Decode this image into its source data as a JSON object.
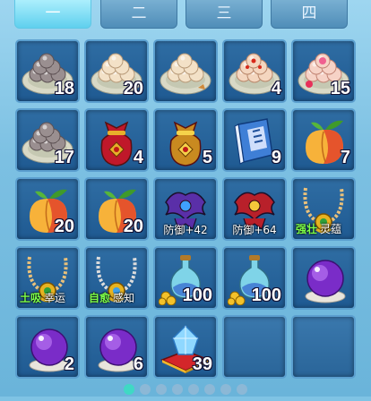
{
  "tabs": [
    {
      "label": "一",
      "active": true
    },
    {
      "label": "二",
      "active": false
    },
    {
      "label": "三",
      "active": false
    },
    {
      "label": "四",
      "active": false
    }
  ],
  "items": [
    {
      "name": "grey-pastry-plate",
      "icon": "grey-dumpling-plate-icon",
      "count": "18"
    },
    {
      "name": "cream-pastry-plate",
      "icon": "cream-dumpling-plate-icon",
      "count": "20"
    },
    {
      "name": "cream-pastry-plate-2",
      "icon": "cream-dumpling-plate-icon",
      "count": ""
    },
    {
      "name": "red-dot-pastry-plate",
      "icon": "red-dot-dumpling-plate-icon",
      "count": "4"
    },
    {
      "name": "flower-pastry-plate",
      "icon": "flower-dumpling-plate-icon",
      "count": "15"
    },
    {
      "name": "grey-pastry-plate-2",
      "icon": "grey-dumpling-plate-icon",
      "count": "17"
    },
    {
      "name": "red-lucky-bag",
      "icon": "red-lucky-bag-icon",
      "count": "4"
    },
    {
      "name": "gold-lucky-bag",
      "icon": "gold-lucky-bag-icon",
      "count": "5"
    },
    {
      "name": "blue-book",
      "icon": "blue-book-icon",
      "count": "9"
    },
    {
      "name": "peach",
      "icon": "peach-icon",
      "count": "7"
    },
    {
      "name": "peach-2",
      "icon": "peach-icon",
      "count": "20"
    },
    {
      "name": "peach-3",
      "icon": "peach-icon",
      "count": "20"
    },
    {
      "name": "blue-armor-crest",
      "icon": "blue-armor-crest-icon",
      "attr": "防御+42"
    },
    {
      "name": "red-armor-crest",
      "icon": "red-armor-crest-icon",
      "attr": "防御+64"
    },
    {
      "name": "gold-necklace-qiangzhuang",
      "icon": "gold-necklace-icon",
      "tag": "强壮",
      "tagtext": "灵蕴"
    },
    {
      "name": "gold-necklace-tuxi",
      "icon": "gold-necklace-icon",
      "tag": "土吸",
      "tagtext": "幸运"
    },
    {
      "name": "silver-necklace-ziyu",
      "icon": "silver-necklace-icon",
      "tag": "自愈",
      "tagtext": "感知"
    },
    {
      "name": "potion-with-coins",
      "icon": "potion-coins-icon",
      "count": "100"
    },
    {
      "name": "potion-with-coins-2",
      "icon": "potion-coins-icon",
      "count": "100"
    },
    {
      "name": "purple-orb",
      "icon": "purple-orb-icon",
      "count": ""
    },
    {
      "name": "purple-orb-2",
      "icon": "purple-orb-icon",
      "count": "2"
    },
    {
      "name": "purple-orb-3",
      "icon": "purple-orb-icon",
      "count": "6"
    },
    {
      "name": "blue-crystal-cushion",
      "icon": "crystal-cushion-icon",
      "count": "39"
    },
    {
      "name": "empty-slot",
      "icon": "",
      "count": ""
    },
    {
      "name": "empty-slot-2",
      "icon": "",
      "count": ""
    }
  ],
  "pager": {
    "total": 8,
    "active": 0
  },
  "colors": {
    "slot": "#1f5a92",
    "tab_active": "#5fd0ee",
    "tag_green": "#7dff4a"
  }
}
